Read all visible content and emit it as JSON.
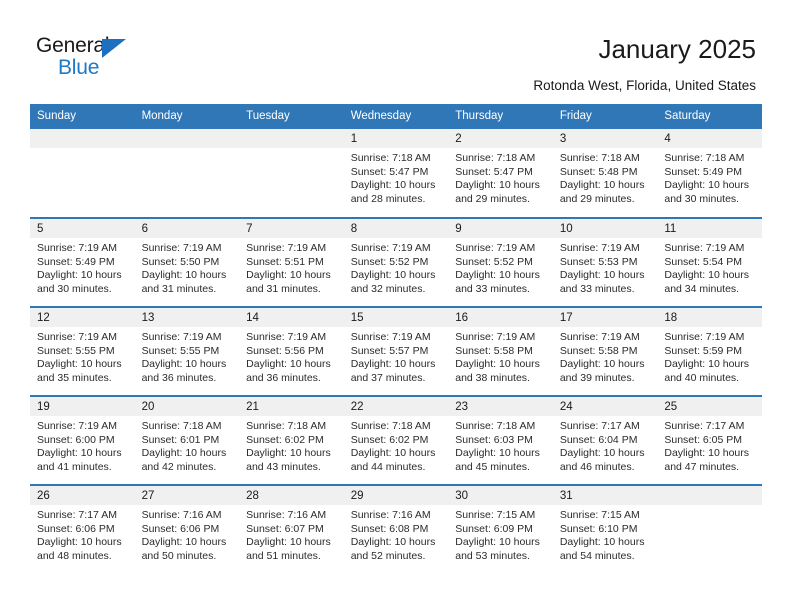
{
  "brand": {
    "name_line1": "General",
    "name_line2": "Blue",
    "logo_icon": "triangle-icon",
    "color_dark": "#1a1a1a",
    "color_blue": "#1f7ac6"
  },
  "header": {
    "title": "January 2025",
    "subtitle": "Rotonda West, Florida, United States"
  },
  "theme": {
    "header_blue": "#3077b7",
    "daynum_gray": "#f0f0f0",
    "text": "#2b2b2b"
  },
  "weekday_headers": [
    "Sunday",
    "Monday",
    "Tuesday",
    "Wednesday",
    "Thursday",
    "Friday",
    "Saturday"
  ],
  "labels": {
    "sunrise_prefix": "Sunrise:",
    "sunset_prefix": "Sunset:",
    "daylight_prefix": "Daylight:"
  },
  "weeks": [
    [
      {
        "day": "",
        "empty": true
      },
      {
        "day": "",
        "empty": true
      },
      {
        "day": "",
        "empty": true
      },
      {
        "day": "1",
        "sunrise": "Sunrise: 7:18 AM",
        "sunset": "Sunset: 5:47 PM",
        "daylight_l1": "Daylight: 10 hours",
        "daylight_l2": "and 28 minutes."
      },
      {
        "day": "2",
        "sunrise": "Sunrise: 7:18 AM",
        "sunset": "Sunset: 5:47 PM",
        "daylight_l1": "Daylight: 10 hours",
        "daylight_l2": "and 29 minutes."
      },
      {
        "day": "3",
        "sunrise": "Sunrise: 7:18 AM",
        "sunset": "Sunset: 5:48 PM",
        "daylight_l1": "Daylight: 10 hours",
        "daylight_l2": "and 29 minutes."
      },
      {
        "day": "4",
        "sunrise": "Sunrise: 7:18 AM",
        "sunset": "Sunset: 5:49 PM",
        "daylight_l1": "Daylight: 10 hours",
        "daylight_l2": "and 30 minutes."
      }
    ],
    [
      {
        "day": "5",
        "sunrise": "Sunrise: 7:19 AM",
        "sunset": "Sunset: 5:49 PM",
        "daylight_l1": "Daylight: 10 hours",
        "daylight_l2": "and 30 minutes."
      },
      {
        "day": "6",
        "sunrise": "Sunrise: 7:19 AM",
        "sunset": "Sunset: 5:50 PM",
        "daylight_l1": "Daylight: 10 hours",
        "daylight_l2": "and 31 minutes."
      },
      {
        "day": "7",
        "sunrise": "Sunrise: 7:19 AM",
        "sunset": "Sunset: 5:51 PM",
        "daylight_l1": "Daylight: 10 hours",
        "daylight_l2": "and 31 minutes."
      },
      {
        "day": "8",
        "sunrise": "Sunrise: 7:19 AM",
        "sunset": "Sunset: 5:52 PM",
        "daylight_l1": "Daylight: 10 hours",
        "daylight_l2": "and 32 minutes."
      },
      {
        "day": "9",
        "sunrise": "Sunrise: 7:19 AM",
        "sunset": "Sunset: 5:52 PM",
        "daylight_l1": "Daylight: 10 hours",
        "daylight_l2": "and 33 minutes."
      },
      {
        "day": "10",
        "sunrise": "Sunrise: 7:19 AM",
        "sunset": "Sunset: 5:53 PM",
        "daylight_l1": "Daylight: 10 hours",
        "daylight_l2": "and 33 minutes."
      },
      {
        "day": "11",
        "sunrise": "Sunrise: 7:19 AM",
        "sunset": "Sunset: 5:54 PM",
        "daylight_l1": "Daylight: 10 hours",
        "daylight_l2": "and 34 minutes."
      }
    ],
    [
      {
        "day": "12",
        "sunrise": "Sunrise: 7:19 AM",
        "sunset": "Sunset: 5:55 PM",
        "daylight_l1": "Daylight: 10 hours",
        "daylight_l2": "and 35 minutes."
      },
      {
        "day": "13",
        "sunrise": "Sunrise: 7:19 AM",
        "sunset": "Sunset: 5:55 PM",
        "daylight_l1": "Daylight: 10 hours",
        "daylight_l2": "and 36 minutes."
      },
      {
        "day": "14",
        "sunrise": "Sunrise: 7:19 AM",
        "sunset": "Sunset: 5:56 PM",
        "daylight_l1": "Daylight: 10 hours",
        "daylight_l2": "and 36 minutes."
      },
      {
        "day": "15",
        "sunrise": "Sunrise: 7:19 AM",
        "sunset": "Sunset: 5:57 PM",
        "daylight_l1": "Daylight: 10 hours",
        "daylight_l2": "and 37 minutes."
      },
      {
        "day": "16",
        "sunrise": "Sunrise: 7:19 AM",
        "sunset": "Sunset: 5:58 PM",
        "daylight_l1": "Daylight: 10 hours",
        "daylight_l2": "and 38 minutes."
      },
      {
        "day": "17",
        "sunrise": "Sunrise: 7:19 AM",
        "sunset": "Sunset: 5:58 PM",
        "daylight_l1": "Daylight: 10 hours",
        "daylight_l2": "and 39 minutes."
      },
      {
        "day": "18",
        "sunrise": "Sunrise: 7:19 AM",
        "sunset": "Sunset: 5:59 PM",
        "daylight_l1": "Daylight: 10 hours",
        "daylight_l2": "and 40 minutes."
      }
    ],
    [
      {
        "day": "19",
        "sunrise": "Sunrise: 7:19 AM",
        "sunset": "Sunset: 6:00 PM",
        "daylight_l1": "Daylight: 10 hours",
        "daylight_l2": "and 41 minutes."
      },
      {
        "day": "20",
        "sunrise": "Sunrise: 7:18 AM",
        "sunset": "Sunset: 6:01 PM",
        "daylight_l1": "Daylight: 10 hours",
        "daylight_l2": "and 42 minutes."
      },
      {
        "day": "21",
        "sunrise": "Sunrise: 7:18 AM",
        "sunset": "Sunset: 6:02 PM",
        "daylight_l1": "Daylight: 10 hours",
        "daylight_l2": "and 43 minutes."
      },
      {
        "day": "22",
        "sunrise": "Sunrise: 7:18 AM",
        "sunset": "Sunset: 6:02 PM",
        "daylight_l1": "Daylight: 10 hours",
        "daylight_l2": "and 44 minutes."
      },
      {
        "day": "23",
        "sunrise": "Sunrise: 7:18 AM",
        "sunset": "Sunset: 6:03 PM",
        "daylight_l1": "Daylight: 10 hours",
        "daylight_l2": "and 45 minutes."
      },
      {
        "day": "24",
        "sunrise": "Sunrise: 7:17 AM",
        "sunset": "Sunset: 6:04 PM",
        "daylight_l1": "Daylight: 10 hours",
        "daylight_l2": "and 46 minutes."
      },
      {
        "day": "25",
        "sunrise": "Sunrise: 7:17 AM",
        "sunset": "Sunset: 6:05 PM",
        "daylight_l1": "Daylight: 10 hours",
        "daylight_l2": "and 47 minutes."
      }
    ],
    [
      {
        "day": "26",
        "sunrise": "Sunrise: 7:17 AM",
        "sunset": "Sunset: 6:06 PM",
        "daylight_l1": "Daylight: 10 hours",
        "daylight_l2": "and 48 minutes."
      },
      {
        "day": "27",
        "sunrise": "Sunrise: 7:16 AM",
        "sunset": "Sunset: 6:06 PM",
        "daylight_l1": "Daylight: 10 hours",
        "daylight_l2": "and 50 minutes."
      },
      {
        "day": "28",
        "sunrise": "Sunrise: 7:16 AM",
        "sunset": "Sunset: 6:07 PM",
        "daylight_l1": "Daylight: 10 hours",
        "daylight_l2": "and 51 minutes."
      },
      {
        "day": "29",
        "sunrise": "Sunrise: 7:16 AM",
        "sunset": "Sunset: 6:08 PM",
        "daylight_l1": "Daylight: 10 hours",
        "daylight_l2": "and 52 minutes."
      },
      {
        "day": "30",
        "sunrise": "Sunrise: 7:15 AM",
        "sunset": "Sunset: 6:09 PM",
        "daylight_l1": "Daylight: 10 hours",
        "daylight_l2": "and 53 minutes."
      },
      {
        "day": "31",
        "sunrise": "Sunrise: 7:15 AM",
        "sunset": "Sunset: 6:10 PM",
        "daylight_l1": "Daylight: 10 hours",
        "daylight_l2": "and 54 minutes."
      },
      {
        "day": "",
        "empty": true
      }
    ]
  ]
}
